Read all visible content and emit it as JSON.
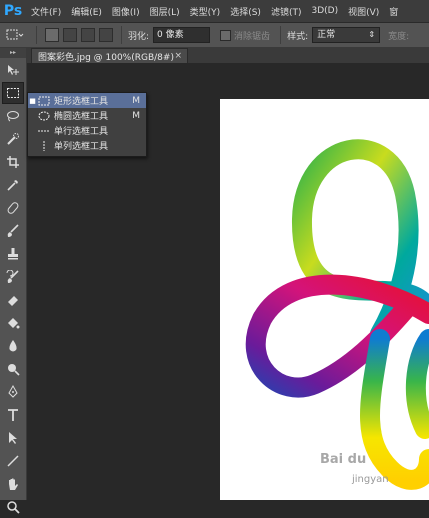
{
  "app": {
    "logo": "Ps"
  },
  "menu": [
    "文件(F)",
    "编辑(E)",
    "图像(I)",
    "图层(L)",
    "类型(Y)",
    "选择(S)",
    "滤镜(T)",
    "3D(D)",
    "视图(V)",
    "窗"
  ],
  "options": {
    "feather_label": "羽化:",
    "feather_value": "0 像素",
    "antialias_label": "消除锯齿",
    "style_label": "样式:",
    "style_value": "正常",
    "width_label": "宽度:"
  },
  "document_tab": {
    "title": "图案彩色.jpg @ 100%(RGB/8#)",
    "close": "×"
  },
  "flyout": [
    {
      "label": "矩形选框工具",
      "key": "M",
      "selected": true,
      "icon": "rect-marquee-icon"
    },
    {
      "label": "椭圆选框工具",
      "key": "M",
      "selected": false,
      "icon": "ellipse-marquee-icon"
    },
    {
      "label": "单行选框工具",
      "key": "",
      "selected": false,
      "icon": "single-row-marquee-icon"
    },
    {
      "label": "单列选框工具",
      "key": "",
      "selected": false,
      "icon": "single-column-marquee-icon"
    }
  ],
  "watermark": {
    "brand": "Bai du",
    "sub": "jingyan"
  },
  "colors": {
    "selection": "#5a6f99",
    "logo": "#30a8ff"
  }
}
